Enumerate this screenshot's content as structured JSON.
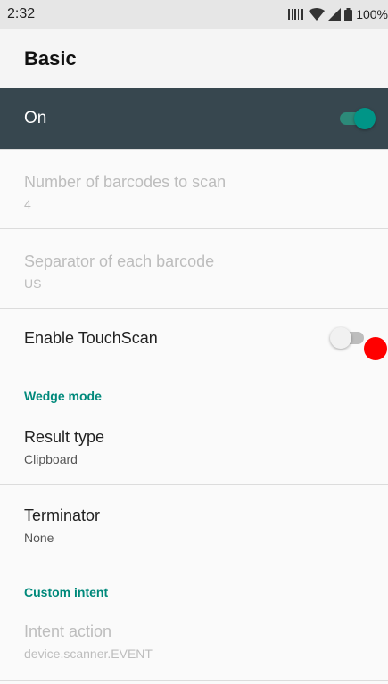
{
  "status_bar": {
    "time": "2:32",
    "battery_text": "100%",
    "icons": [
      "barcode-scanner-icon",
      "wifi-icon",
      "signal-icon",
      "battery-icon"
    ]
  },
  "app_bar": {
    "title": "Basic"
  },
  "master_switch": {
    "label": "On",
    "checked": true
  },
  "preferences": {
    "num_barcodes": {
      "title": "Number of barcodes to scan",
      "summary": "4",
      "enabled": false
    },
    "separator": {
      "title": "Separator of each barcode",
      "summary": "US",
      "enabled": false
    },
    "touchscan": {
      "title": "Enable TouchScan",
      "checked": false,
      "enabled": true
    },
    "result_type": {
      "title": "Result type",
      "summary": "Clipboard",
      "enabled": true
    },
    "terminator": {
      "title": "Terminator",
      "summary": "None",
      "enabled": true
    },
    "intent_action": {
      "title": "Intent action",
      "summary": "device.scanner.EVENT",
      "enabled": false
    }
  },
  "categories": {
    "wedge": "Wedge mode",
    "custom_intent": "Custom intent"
  },
  "colors": {
    "accent": "#009587",
    "header": "#37474f",
    "category": "#00897b",
    "touch_indicator": "#ff0000"
  }
}
